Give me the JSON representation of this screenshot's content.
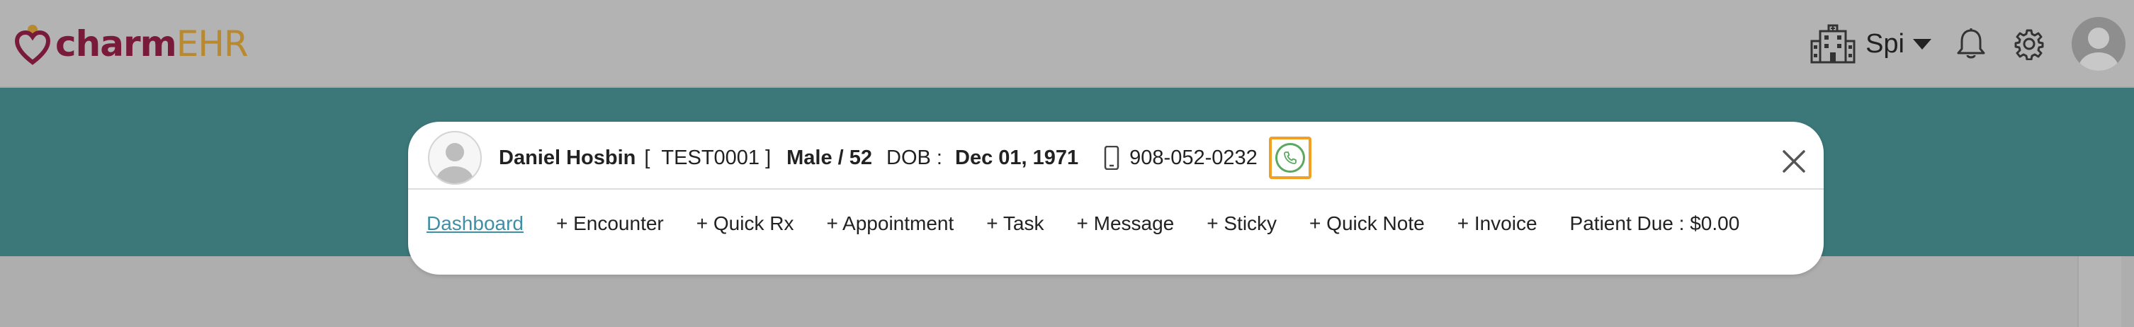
{
  "app": {
    "logo_part1": "charm",
    "logo_part2": "EHR"
  },
  "header": {
    "facility_label": "Spi",
    "icons": [
      "facility-building-icon",
      "bell-icon",
      "gear-icon",
      "user-avatar-icon"
    ]
  },
  "patient": {
    "name": "Daniel Hosbin",
    "id_open": "[",
    "id": "TEST0001",
    "id_close": "]",
    "gender_age": "Male / 52",
    "dob_label": "DOB :",
    "dob": "Dec 01, 1971",
    "phone": "908-052-0232"
  },
  "actions": {
    "dashboard": "Dashboard",
    "encounter": "+ Encounter",
    "quick_rx": "+ Quick Rx",
    "appointment": "+ Appointment",
    "task": "+ Task",
    "message": "+ Message",
    "sticky": "+ Sticky",
    "quick_note": "+ Quick Note",
    "invoice": "+ Invoice",
    "patient_due": "Patient Due : $0.00"
  },
  "colors": {
    "teal": "#3c7779",
    "link": "#3f8fa6",
    "call_highlight": "#f0a024",
    "call_green": "#5aa95f",
    "logo_maroon": "#7a1a3a",
    "logo_gold": "#b8892e"
  }
}
